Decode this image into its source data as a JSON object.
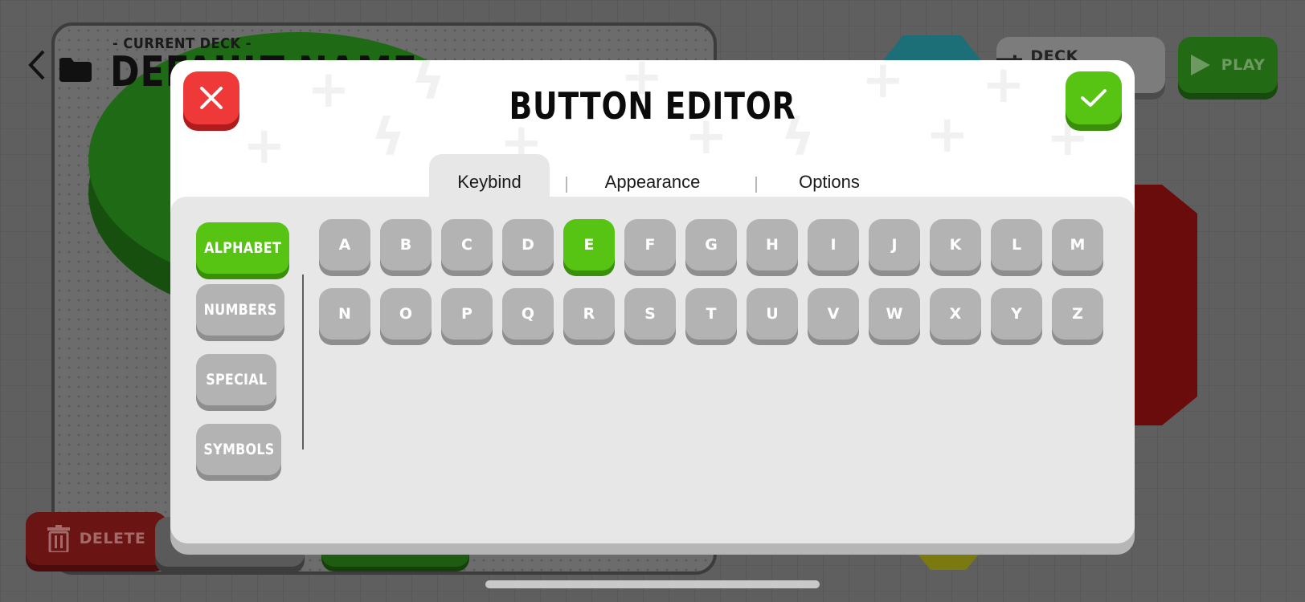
{
  "background": {
    "current_deck_label": "- CURRENT DECK -",
    "deck_name": "DEFAULT NAME",
    "deck_settings_label": "DECK SETTINGS",
    "play_label": "PLAY",
    "delete_label": "DELETE"
  },
  "modal": {
    "title": "BUTTON EDITOR",
    "tabs": [
      "Keybind",
      "Appearance",
      "Options"
    ],
    "active_tab": "Keybind",
    "categories": [
      "ALPHABET",
      "NUMBERS",
      "SPECIAL",
      "SYMBOLS"
    ],
    "active_category": "ALPHABET",
    "keys": [
      "A",
      "B",
      "C",
      "D",
      "E",
      "F",
      "G",
      "H",
      "I",
      "J",
      "K",
      "L",
      "M",
      "N",
      "O",
      "P",
      "Q",
      "R",
      "S",
      "T",
      "U",
      "V",
      "W",
      "X",
      "Y",
      "Z"
    ],
    "selected_key": "E"
  },
  "colors": {
    "accent_green": "#57c313",
    "close_red": "#ef3838",
    "key_grey": "#b3b3b3"
  },
  "icons": {
    "close": "x-icon",
    "confirm": "check-icon",
    "back": "chevron-left-icon",
    "folder": "folder-icon",
    "play": "play-icon",
    "settings": "sliders-icon",
    "delete": "trash-icon"
  }
}
